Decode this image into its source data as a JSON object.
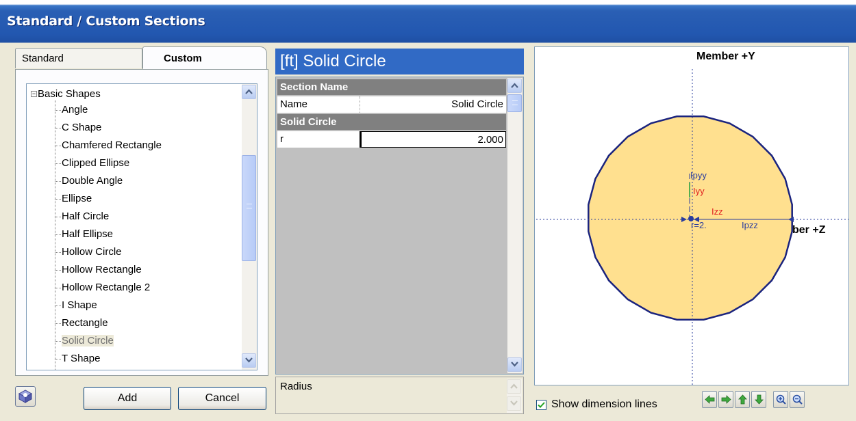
{
  "window": {
    "title": "Standard / Custom Sections"
  },
  "tabs": {
    "standard": "Standard",
    "custom": "Custom"
  },
  "tree": {
    "root": "Basic Shapes",
    "items": [
      "Angle",
      "C Shape",
      "Chamfered Rectangle",
      "Clipped Ellipse",
      "Double Angle",
      "Ellipse",
      "Half Circle",
      "Half Ellipse",
      "Hollow Circle",
      "Hollow Rectangle",
      "Hollow Rectangle 2",
      "I Shape",
      "Rectangle",
      "Solid Circle",
      "T Shape"
    ],
    "selected": "Solid Circle"
  },
  "buttons": {
    "add": "Add",
    "cancel": "Cancel",
    "help_icon": "help-book-icon"
  },
  "properties": {
    "header": "[ft] Solid Circle",
    "cat_section_name": "Section Name",
    "name_key": "Name",
    "name_value": "Solid Circle",
    "cat_solid_circle": "Solid Circle",
    "r_key": "r",
    "r_value": "2.000",
    "description": "Radius"
  },
  "viewer": {
    "axis_y": "Member +Y",
    "axis_z": "ber +Z",
    "label_ipyy": "Ipyy",
    "label_iyy": "Iyy",
    "label_izz": "Izz",
    "label_ipzz": "Ipzz",
    "label_r": "r=2.",
    "circle_fill": "#ffe08f",
    "circle_stroke": "#1a237e",
    "show_dimension_lines": "Show dimension lines",
    "show_dimension_checked": true,
    "nav_icons": [
      "pan-left-icon",
      "pan-right-icon",
      "pan-up-icon",
      "pan-down-icon",
      "zoom-in-icon",
      "zoom-out-icon"
    ]
  }
}
